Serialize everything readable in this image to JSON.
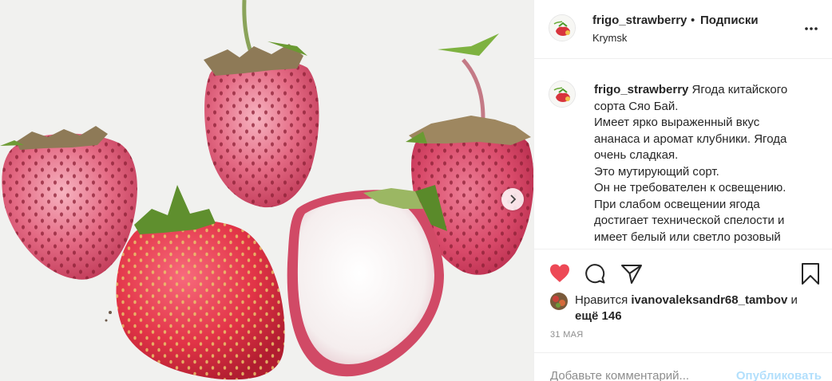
{
  "post": {
    "username": "frigo_strawberry",
    "separator": "•",
    "follow_label": "Подписки",
    "location": "Krymsk",
    "avatar_icon": "strawberry-logo-icon",
    "caption_lines": [
      "Ягода китайского",
      "сорта Сяо Бай.",
      "Имеет ярко выраженный вкус",
      "ананаса и аромат клубники. Ягода",
      "очень сладкая.",
      "Это мутирующий сорт.",
      "Он не требователен к освещению.",
      "При слабом освещении ягода",
      "достигает технической спелости и",
      "имеет белый или светло розовый"
    ],
    "likes_prefix": "Нравится",
    "likes_user": "ivanovaleksandr68_tambov",
    "likes_conj": "и",
    "likes_more": "ещё 146",
    "date": "31 МАЯ",
    "comment_placeholder": "Добавьте комментарий...",
    "publish_label": "Опубликовать"
  },
  "icons": {
    "like": "heart-filled-icon",
    "comment": "comment-bubble-icon",
    "share": "paper-plane-icon",
    "save": "bookmark-icon",
    "more": "more-horizontal-icon",
    "next": "chevron-right-icon"
  },
  "colors": {
    "like_red": "#ed4956",
    "publish_blue": "#b2dffc",
    "muted": "#8e8e8e",
    "text": "#262626"
  }
}
